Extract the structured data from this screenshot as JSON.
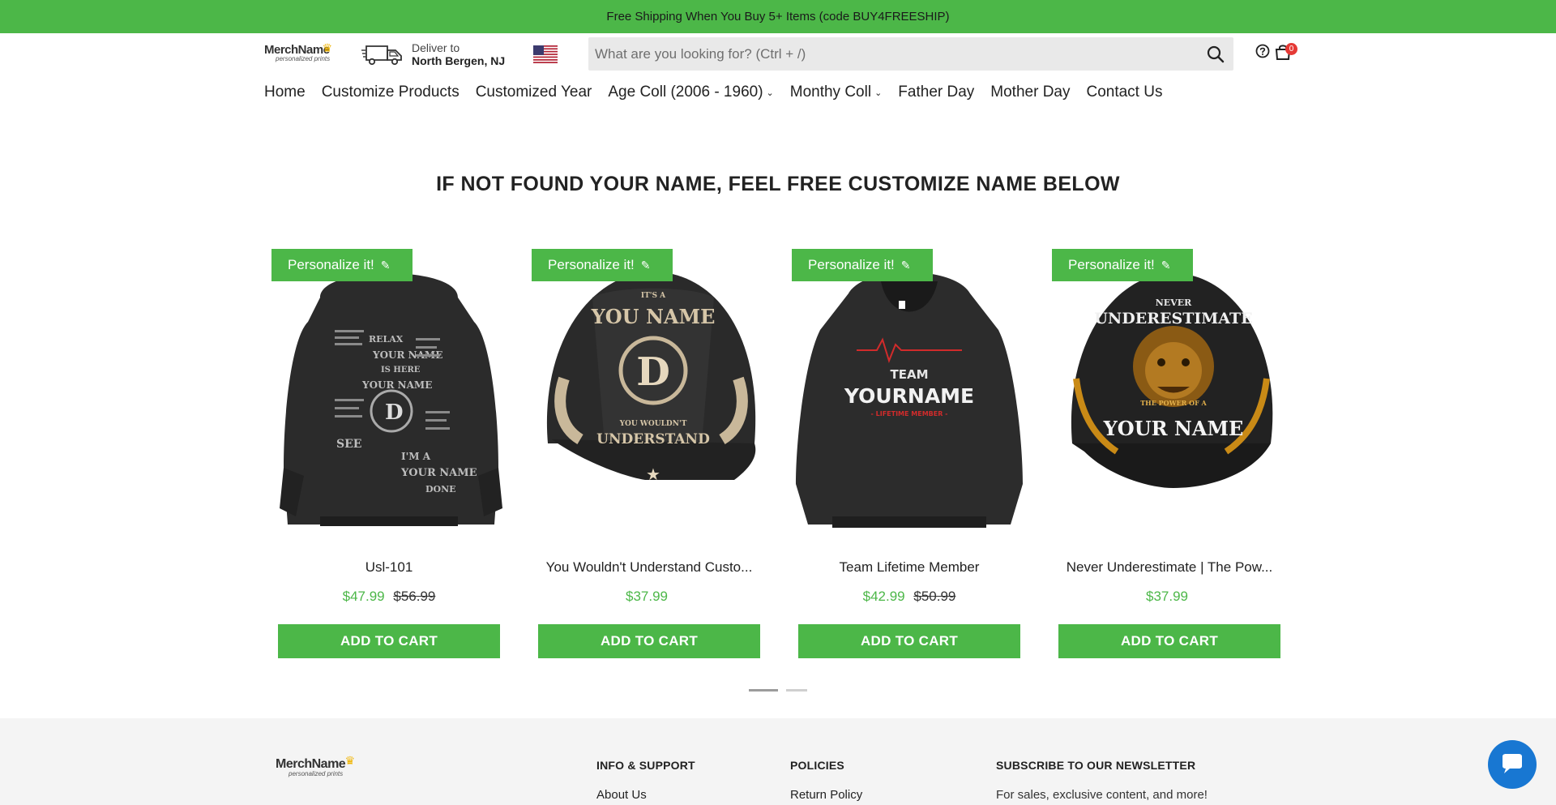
{
  "announcement": "Free Shipping When You Buy 5+ Items (code BUY4FREESHIP)",
  "header": {
    "logo_text_main": "MerchName",
    "logo_text_sub": "personalized prints",
    "deliver_label": "Deliver to",
    "deliver_location": "North Bergen, NJ",
    "search_placeholder": "What are you looking for? (Ctrl + /)",
    "cart_count": "0"
  },
  "nav": [
    {
      "label": "Home"
    },
    {
      "label": "Customize Products"
    },
    {
      "label": "Customized Year"
    },
    {
      "label": "Age Coll (2006 - 1960)",
      "caret": "⌄"
    },
    {
      "label": "Monthy Coll",
      "caret": "⌄"
    },
    {
      "label": "Father Day"
    },
    {
      "label": "Mother Day"
    },
    {
      "label": "Contact Us"
    }
  ],
  "section_heading": "IF NOT FOUND YOUR NAME, FEEL FREE CUSTOMIZE NAME BELOW",
  "products": [
    {
      "badge": "Personalize it!",
      "title": "Usl-101",
      "price": "$47.99",
      "compare_price": "$56.99",
      "button": "ADD TO CART"
    },
    {
      "badge": "Personalize it!",
      "title": "You Wouldn't Understand Custo...",
      "price": "$37.99",
      "compare_price": "",
      "button": "ADD TO CART"
    },
    {
      "badge": "Personalize it!",
      "title": "Team Lifetime Member",
      "price": "$42.99",
      "compare_price": "$50.99",
      "button": "ADD TO CART"
    },
    {
      "badge": "Personalize it!",
      "title": "Never Underestimate | The Pow...",
      "price": "$37.99",
      "compare_price": "",
      "button": "ADD TO CART"
    }
  ],
  "image_text": {
    "p1": [
      "RELAX",
      "YOUR NAME",
      "IS HERE",
      "YOUR NAME",
      "SEE",
      "I'M A",
      "YOUR NAME",
      "DONE"
    ],
    "p2": [
      "IT'S A",
      "YOU NAME",
      "YOU WOULDN'T",
      "UNDERSTAND"
    ],
    "p3": [
      "TEAM",
      "YOURNAME",
      "- LIFETIME MEMBER -"
    ],
    "p4": [
      "NEVER",
      "UNDERESTIMATE",
      "THE POWER OF A",
      "YOUR NAME"
    ]
  },
  "footer": {
    "col1_heading": "INFO & SUPPORT",
    "col1_link": "About Us",
    "col2_heading": "POLICIES",
    "col2_link": "Return Policy",
    "col3_heading": "SUBSCRIBE TO OUR NEWSLETTER",
    "col3_text": "For sales, exclusive content, and more!"
  },
  "colors": {
    "brand_green": "#4cb748",
    "badge_red": "#e53935",
    "chat_blue": "#1877d2"
  },
  "icons": [
    "truck-icon",
    "us-flag-icon",
    "search-icon",
    "help-icon",
    "bag-icon",
    "pencil-icon",
    "chat-icon"
  ]
}
